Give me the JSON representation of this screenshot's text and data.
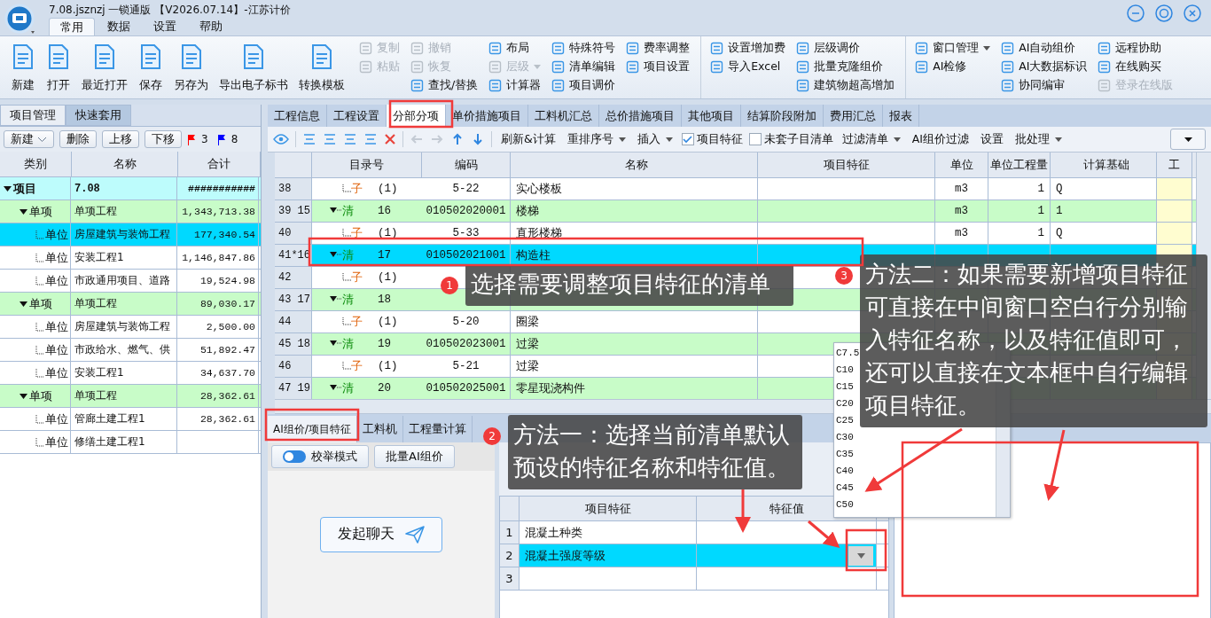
{
  "app": {
    "title": "7.08.jsznzj 一锁通版 【V2026.07.14】-江苏计价",
    "menu_tabs": [
      {
        "label": "常用",
        "selected": true
      },
      {
        "label": "数据",
        "selected": false
      },
      {
        "label": "设置",
        "selected": false
      },
      {
        "label": "帮助",
        "selected": false
      }
    ]
  },
  "ribbon": {
    "large_buttons": [
      "新建",
      "打开",
      "最近打开",
      "保存",
      "另存为",
      "导出电子标书",
      "转换模板"
    ],
    "groups": [
      {
        "columns": [
          [
            {
              "label": "复制",
              "disabled": true
            },
            {
              "label": "粘贴",
              "disabled": true
            }
          ],
          [
            {
              "label": "撤销",
              "disabled": true
            },
            {
              "label": "恢复",
              "disabled": true
            },
            {
              "label": "查找/替换",
              "disabled": false
            }
          ],
          [
            {
              "label": "布局",
              "disabled": false
            },
            {
              "label": "层级",
              "disabled": true,
              "dropdown": true
            },
            {
              "label": "计算器",
              "disabled": false
            }
          ],
          [
            {
              "label": "特殊符号",
              "disabled": false
            },
            {
              "label": "清单编辑",
              "disabled": false
            },
            {
              "label": "项目调价",
              "disabled": false
            }
          ],
          [
            {
              "label": "费率调整",
              "disabled": false
            },
            {
              "label": "项目设置",
              "disabled": false
            }
          ]
        ]
      },
      {
        "columns": [
          [
            {
              "label": "设置增加费",
              "disabled": false
            },
            {
              "label": "导入Excel",
              "disabled": false
            }
          ],
          [
            {
              "label": "层级调价",
              "disabled": false
            },
            {
              "label": "批量克隆组价",
              "disabled": false
            },
            {
              "label": "建筑物超高增加",
              "disabled": false
            }
          ]
        ]
      },
      {
        "columns": [
          [
            {
              "label": "窗口管理",
              "disabled": false,
              "dropdown": true
            },
            {
              "label": "AI检修",
              "disabled": false
            }
          ],
          [
            {
              "label": "AI自动组价",
              "disabled": false
            },
            {
              "label": "AI大数据标识",
              "disabled": false
            },
            {
              "label": "协同编审",
              "disabled": false
            }
          ],
          [
            {
              "label": "远程协助",
              "disabled": false
            },
            {
              "label": "在线购买",
              "disabled": false
            },
            {
              "label": "登录在线版",
              "disabled": true
            }
          ]
        ]
      }
    ]
  },
  "project_panel": {
    "tabs": [
      {
        "label": "项目管理",
        "selected": true
      },
      {
        "label": "快速套用",
        "selected": false
      }
    ],
    "buttons": [
      {
        "label": "新建",
        "dropdown": true
      },
      {
        "label": "删除"
      },
      {
        "label": "上移"
      },
      {
        "label": "下移"
      }
    ],
    "flags": [
      {
        "color": "#ff0000",
        "count": "3"
      },
      {
        "color": "#0000ff",
        "count": "8"
      }
    ],
    "columns": [
      "类别",
      "名称",
      "合计"
    ],
    "tree": [
      {
        "kind": "项目",
        "name": "7.08",
        "total": "###########",
        "expanded": true,
        "selected": false,
        "children": [
          {
            "kind": "单项",
            "name": "单项工程",
            "total": "1,343,713.38",
            "expanded": true,
            "selected": false,
            "children": [
              {
                "kind": "单位",
                "name": "房屋建筑与装饰工程",
                "total": "177,340.54",
                "selected": true
              },
              {
                "kind": "单位",
                "name": "安装工程1",
                "total": "1,146,847.86",
                "selected": false
              },
              {
                "kind": "单位",
                "name": "市政通用项目、道路",
                "total": "19,524.98",
                "selected": false
              }
            ]
          },
          {
            "kind": "单项",
            "name": "单项工程",
            "total": "89,030.17",
            "expanded": true,
            "selected": false,
            "children": [
              {
                "kind": "单位",
                "name": "房屋建筑与装饰工程",
                "total": "2,500.00",
                "selected": false
              },
              {
                "kind": "单位",
                "name": "市政给水、燃气、供",
                "total": "51,892.47",
                "selected": false
              },
              {
                "kind": "单位",
                "name": "安装工程1",
                "total": "34,637.70",
                "selected": false
              }
            ]
          },
          {
            "kind": "单项",
            "name": "单项工程",
            "total": "28,362.61",
            "expanded": true,
            "selected": false,
            "children": [
              {
                "kind": "单位",
                "name": "管廊土建工程1",
                "total": "28,362.61",
                "selected": false
              },
              {
                "kind": "单位",
                "name": "修缮土建工程1",
                "selected": false
              }
            ]
          }
        ]
      }
    ]
  },
  "main_tabs": [
    {
      "label": "工程信息",
      "selected": false
    },
    {
      "label": "工程设置",
      "selected": false
    },
    {
      "label": "分部分项",
      "selected": true
    },
    {
      "label": "单价措施项目",
      "selected": false
    },
    {
      "label": "工料机汇总",
      "selected": false
    },
    {
      "label": "总价措施项目",
      "selected": false
    },
    {
      "label": "其他项目",
      "selected": false
    },
    {
      "label": "结算阶段附加",
      "selected": false
    },
    {
      "label": "费用汇总",
      "selected": false
    },
    {
      "label": "报表",
      "selected": false
    }
  ],
  "toolbar": {
    "arrow_buttons": [
      {
        "disabled": true
      },
      {
        "disabled": true
      },
      {
        "disabled": false
      },
      {
        "disabled": false
      }
    ],
    "items": [
      {
        "kind": "button",
        "label": "刷新&计算"
      },
      {
        "kind": "menu",
        "label": "重排序号"
      },
      {
        "kind": "menu",
        "label": "插入"
      },
      {
        "kind": "checkbox",
        "label": "项目特征",
        "checked": true
      },
      {
        "kind": "checkbox",
        "label": "未套子目清单",
        "checked": false
      },
      {
        "kind": "menu",
        "label": "过滤清单"
      },
      {
        "kind": "button",
        "label": "AI组价过滤"
      },
      {
        "kind": "button",
        "label": "设置"
      },
      {
        "kind": "menu",
        "label": "批处理"
      }
    ]
  },
  "bill_table": {
    "columns": [
      "目录号",
      "编码",
      "名称",
      "项目特征",
      "单位",
      "单位工程量",
      "计算基础",
      "工"
    ],
    "rows": [
      {
        "row_no": "38",
        "kind": "sub",
        "type_label": "子",
        "index": "(1)",
        "code": "5-22",
        "name": "实心楼板",
        "unit": "m3",
        "quantity": "1",
        "base": "Q",
        "selected": false
      },
      {
        "row_no": "39 15",
        "kind": "bill",
        "type_label": "清",
        "index": "16",
        "code": "010502020001",
        "name": "楼梯",
        "unit": "m3",
        "quantity": "1",
        "base": "1",
        "selected": false
      },
      {
        "row_no": "40",
        "kind": "sub",
        "type_label": "子",
        "index": "(1)",
        "code": "5-33",
        "name": "直形楼梯",
        "unit": "m3",
        "quantity": "1",
        "base": "Q",
        "selected": false
      },
      {
        "row_no": "41*16",
        "kind": "bill",
        "type_label": "清",
        "index": "17",
        "code": "010502021001",
        "name": "构造柱",
        "selected": true
      },
      {
        "row_no": "42",
        "kind": "sub",
        "type_label": "子",
        "index": "(1)",
        "selected": false
      },
      {
        "row_no": "43 17",
        "kind": "bill",
        "type_label": "清",
        "index": "18",
        "selected": false
      },
      {
        "row_no": "44",
        "kind": "sub",
        "type_label": "子",
        "index": "(1)",
        "code": "5-20",
        "name": "圈梁",
        "selected": false
      },
      {
        "row_no": "45 18",
        "kind": "bill",
        "type_label": "清",
        "index": "19",
        "code": "010502023001",
        "name": "过梁",
        "selected": false
      },
      {
        "row_no": "46",
        "kind": "sub",
        "type_label": "子",
        "index": "(1)",
        "code": "5-21",
        "name": "过梁",
        "selected": false
      },
      {
        "row_no": "47 19",
        "kind": "bill",
        "type_label": "清",
        "index": "20",
        "code": "010502025001",
        "name": "零星现浇构件",
        "selected": false
      }
    ]
  },
  "detail_tabs": [
    {
      "label": "AI组价/项目特征",
      "selected": true
    },
    {
      "label": "工料机",
      "selected": false
    },
    {
      "label": "工程量计算",
      "selected": false
    }
  ],
  "ai_panel": {
    "mode_switch": {
      "label": "校举模式",
      "on": true
    },
    "batch_button": "批量AI组价",
    "chat_button": "发起聊天"
  },
  "feature_table": {
    "columns": [
      "项目特征",
      "特征值"
    ],
    "rows": [
      {
        "no": "1",
        "name": "混凝土种类",
        "selected": false
      },
      {
        "no": "2",
        "name": "混凝土强度等级",
        "selected": true
      },
      {
        "no": "3",
        "selected": false
      }
    ]
  },
  "grade_dropdown": {
    "options": [
      "C7.5",
      "C10",
      "C15",
      "C20",
      "C25",
      "C30",
      "C35",
      "C40",
      "C45",
      "C50"
    ]
  },
  "callouts": [
    {
      "number": "1",
      "text": "选择需要调整项目特征的清单"
    },
    {
      "number": "2",
      "text": "方法一：选择当前清单默认预设的特征名称和特征值。"
    },
    {
      "number": "3",
      "text": "方法二：如果需要新增项目特征可直接在中间窗口空白行分别输入特征名称，以及特征值即可，还可以直接在文本框中自行编辑项目特征。"
    }
  ]
}
